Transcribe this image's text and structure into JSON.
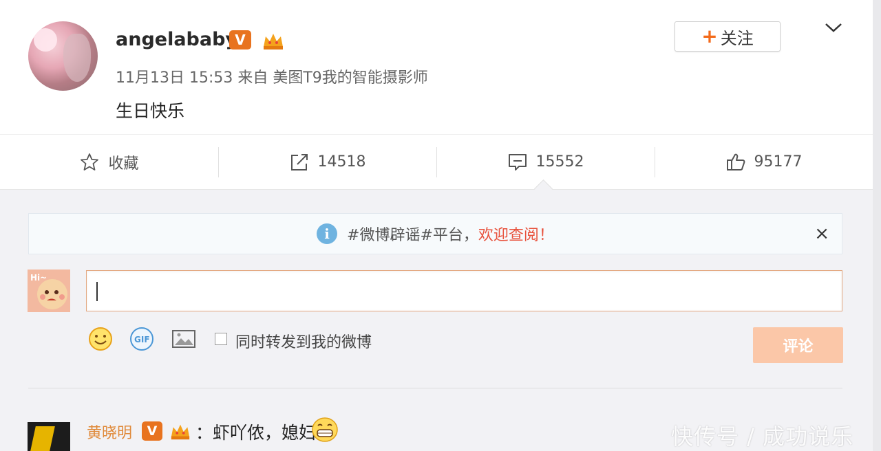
{
  "post": {
    "username": "angelababy",
    "verified_badge": "V",
    "meta": "11月13日 15:53 来自 美图T9我的智能摄影师",
    "text": "生日快乐",
    "follow_plus": "+",
    "follow_label": "关注"
  },
  "actions": {
    "favorite_label": "收藏",
    "repost_count": "14518",
    "comment_count": "15552",
    "like_count": "95177"
  },
  "notice": {
    "text_prefix": "#微博辟谣#平台，",
    "text_highlight": "欢迎查阅！",
    "close": "×"
  },
  "composer": {
    "sync_label": "同时转发到我的微博",
    "submit_label": "评论"
  },
  "comment": {
    "author": "黄晓明",
    "verified_badge": "V",
    "text": "：虾吖侬，媳妇"
  },
  "watermark": "快传号 / 成功说乐",
  "colors": {
    "accent": "#f36a1a",
    "highlight": "#e8513c",
    "verified": "#e8731f",
    "submit_disabled": "#fbc7a8"
  }
}
